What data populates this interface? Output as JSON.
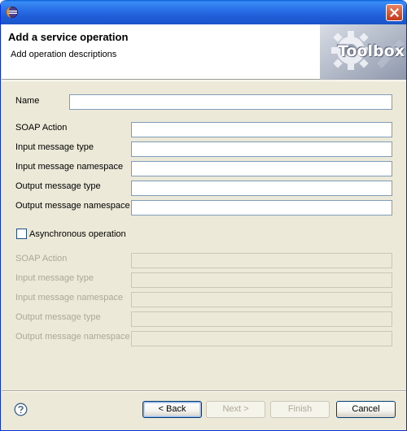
{
  "window": {
    "title": ""
  },
  "banner": {
    "title": "Add a service operation",
    "subtitle": "Add operation descriptions",
    "logo_text": "Toolbox"
  },
  "form": {
    "name_label": "Name",
    "name_value": "",
    "fields": [
      {
        "label": "SOAP Action",
        "value": ""
      },
      {
        "label": "Input message type",
        "value": ""
      },
      {
        "label": "Input message namespace",
        "value": ""
      },
      {
        "label": "Output message type",
        "value": ""
      },
      {
        "label": "Output message namespace",
        "value": ""
      }
    ],
    "async_label": "Asynchronous operation",
    "async_checked": false,
    "async_fields": [
      {
        "label": "SOAP Action",
        "value": ""
      },
      {
        "label": "Input message type",
        "value": ""
      },
      {
        "label": "Input message namespace",
        "value": ""
      },
      {
        "label": "Output message type",
        "value": ""
      },
      {
        "label": "Output message namespace",
        "value": ""
      }
    ]
  },
  "buttons": {
    "back": "< Back",
    "next": "Next >",
    "finish": "Finish",
    "cancel": "Cancel"
  },
  "icons": {
    "app": "eclipse-icon",
    "close": "close-icon",
    "help": "help-icon"
  },
  "colors": {
    "titlebar": "#1f5cd6",
    "dialog_bg": "#ece9d8",
    "disabled_text": "#aca899"
  }
}
